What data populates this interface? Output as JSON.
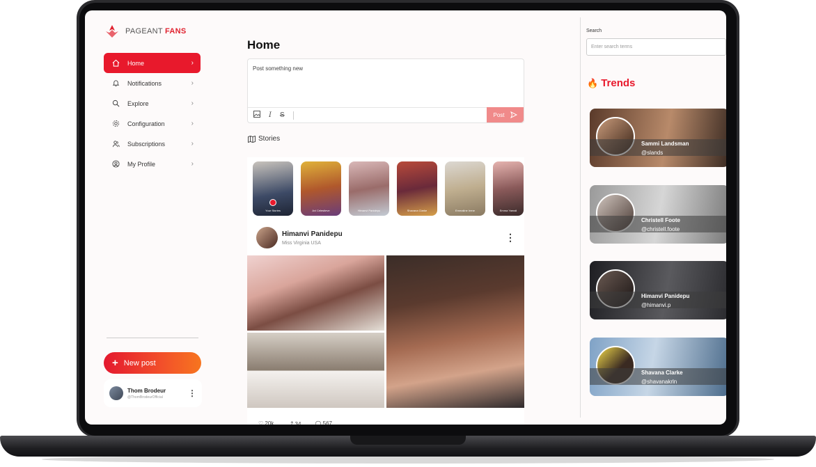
{
  "brand": {
    "name_part1": "PAGEANT",
    "name_part2": "FANS",
    "accent": "#e8192c"
  },
  "sidebar": {
    "items": [
      {
        "label": "Home",
        "icon": "home-icon",
        "active": true
      },
      {
        "label": "Notifications",
        "icon": "bell-icon",
        "active": false
      },
      {
        "label": "Explore",
        "icon": "search-icon",
        "active": false
      },
      {
        "label": "Configuration",
        "icon": "gear-icon",
        "active": false
      },
      {
        "label": "Subscriptions",
        "icon": "users-icon",
        "active": false
      },
      {
        "label": "My Profile",
        "icon": "user-circle-icon",
        "active": false
      }
    ],
    "new_post_label": "New post",
    "user": {
      "name": "Thom Brodeur",
      "handle": "@ThomBrodeurOfficial"
    }
  },
  "main": {
    "title": "Home",
    "composer": {
      "placeholder": "Post something new",
      "post_label": "Post"
    },
    "stories_label": "Stories",
    "stories": [
      {
        "name": "Your Stories"
      },
      {
        "name": "Avi Celestieve"
      },
      {
        "name": "Himanvi Panidepu"
      },
      {
        "name": "Shavana Clarke"
      },
      {
        "name": "Emmaline Irene"
      },
      {
        "name": "Emma Yamali"
      }
    ],
    "post": {
      "author": "Himanvi Panidepu",
      "subtitle": "Miss Virginia USA",
      "likes": "20k",
      "shares": "34",
      "comments": "567"
    }
  },
  "right": {
    "search_label": "Search",
    "search_placeholder": "Enter search terms",
    "trends_label": "Trends",
    "trends": [
      {
        "name": "Sammi Landsman",
        "handle": "@slands"
      },
      {
        "name": "Christell Foote",
        "handle": "@christell.foote"
      },
      {
        "name": "Himanvi Panidepu",
        "handle": "@himanvi.p"
      },
      {
        "name": "Shavana Clarke",
        "handle": "@shavanakrln"
      }
    ]
  }
}
